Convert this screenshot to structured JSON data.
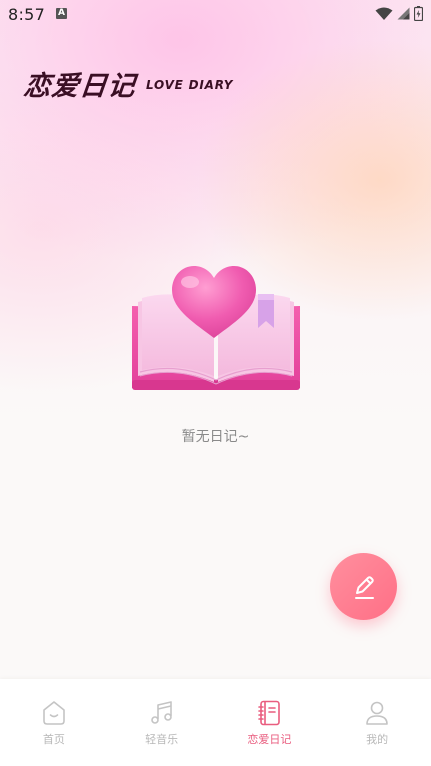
{
  "status_bar": {
    "time": "8:57",
    "notification_badge": "A",
    "icons": [
      "wifi-icon",
      "signal-icon",
      "battery-icon"
    ]
  },
  "header": {
    "title": "恋爱日记",
    "subtitle": "LOVE DIARY"
  },
  "main": {
    "empty_illustration": "heart-book-illustration",
    "empty_text": "暂无日记~"
  },
  "fab": {
    "icon": "pencil-icon"
  },
  "bottom_nav": {
    "items": [
      {
        "label": "首页",
        "icon": "home-icon",
        "active": false
      },
      {
        "label": "轻音乐",
        "icon": "music-note-icon",
        "active": false
      },
      {
        "label": "恋爱日记",
        "icon": "notebook-icon",
        "active": true
      },
      {
        "label": "我的",
        "icon": "person-icon",
        "active": false
      }
    ]
  },
  "colors": {
    "accent": "#e95d7f",
    "fab": "#ff7890",
    "title": "#3a0f24",
    "inactive": "#b8b8b8"
  }
}
